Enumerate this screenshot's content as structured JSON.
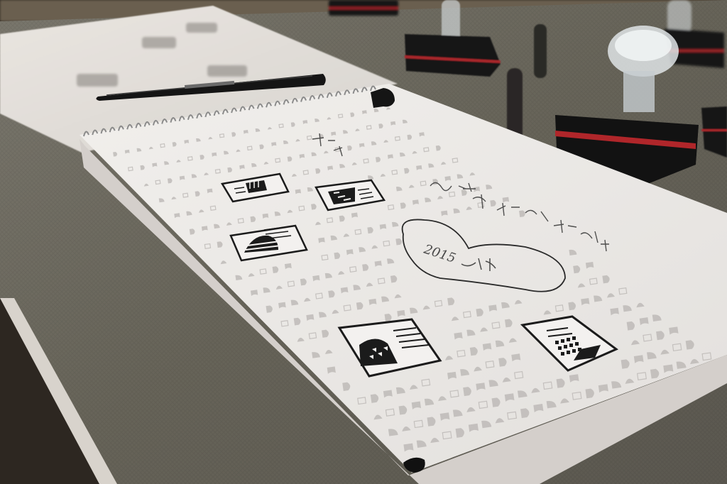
{
  "scene": {
    "description_free": true,
    "colors": {
      "floor": "#2f2a24",
      "tablecloth": "#6d6a60",
      "tablecloth_dark": "#56534b",
      "paper": "#ece9e6",
      "paper_shadow": "#cfcac6",
      "ink": "#1b1b1b",
      "faint_stamp": "#b9b5b2",
      "stamp_base": "#151515",
      "stamp_stripe": "#b0262a",
      "glass": "#d9dee0"
    }
  },
  "handwriting": {
    "year_text": "2015",
    "heart_note": "2015级"
  },
  "notebook": {
    "stamps_count_visible": 6
  },
  "pen": {
    "type": "black pen"
  }
}
